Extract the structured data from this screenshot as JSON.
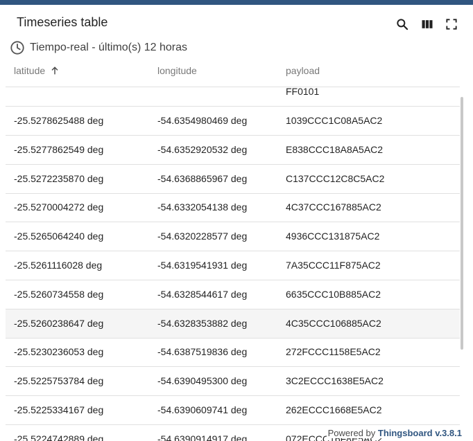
{
  "widget": {
    "title": "Timeseries table",
    "timewindow": "Tiempo-real - último(s) 12 horas"
  },
  "toolbar": {
    "search_icon": "search-icon",
    "columns_icon": "view-column-icon",
    "fullscreen_icon": "fullscreen-icon"
  },
  "columns": [
    {
      "label": "latitude",
      "sort": "ascending"
    },
    {
      "label": "longitude"
    },
    {
      "label": "payload"
    }
  ],
  "partial_row": {
    "payload": "FF0101"
  },
  "rows": [
    {
      "latitude": "-25.5278625488 deg",
      "longitude": "-54.6354980469 deg",
      "payload": "1039CCC1C08A5AC2"
    },
    {
      "latitude": "-25.5277862549 deg",
      "longitude": "-54.6352920532 deg",
      "payload": "E838CCC18A8A5AC2"
    },
    {
      "latitude": "-25.5272235870 deg",
      "longitude": "-54.6368865967 deg",
      "payload": "C137CCC12C8C5AC2"
    },
    {
      "latitude": "-25.5270004272 deg",
      "longitude": "-54.6332054138 deg",
      "payload": "4C37CCC167885AC2"
    },
    {
      "latitude": "-25.5265064240 deg",
      "longitude": "-54.6320228577 deg",
      "payload": "4936CCC131875AC2"
    },
    {
      "latitude": "-25.5261116028 deg",
      "longitude": "-54.6319541931 deg",
      "payload": "7A35CCC11F875AC2"
    },
    {
      "latitude": "-25.5260734558 deg",
      "longitude": "-54.6328544617 deg",
      "payload": "6635CCC10B885AC2"
    },
    {
      "latitude": "-25.5260238647 deg",
      "longitude": "-54.6328353882 deg",
      "payload": "4C35CCC106885AC2"
    },
    {
      "latitude": "-25.5230236053 deg",
      "longitude": "-54.6387519836 deg",
      "payload": "272FCCC1158E5AC2"
    },
    {
      "latitude": "-25.5225753784 deg",
      "longitude": "-54.6390495300 deg",
      "payload": "3C2ECCC1638E5AC2"
    },
    {
      "latitude": "-25.5225334167 deg",
      "longitude": "-54.6390609741 deg",
      "payload": "262ECCC1668E5AC2"
    },
    {
      "latitude": "-25.5224742889 deg",
      "longitude": "-54.6390914917 deg",
      "payload": "072ECCC16F8E5AC2"
    }
  ],
  "highlighted_row": 7,
  "footer": {
    "powered_by": "Powered by",
    "brand": "Thingsboard v.3.8.1"
  },
  "colors": {
    "top_bar": "#305680",
    "brand_link": "#305680",
    "row_highlight": "#f5f5f5"
  }
}
